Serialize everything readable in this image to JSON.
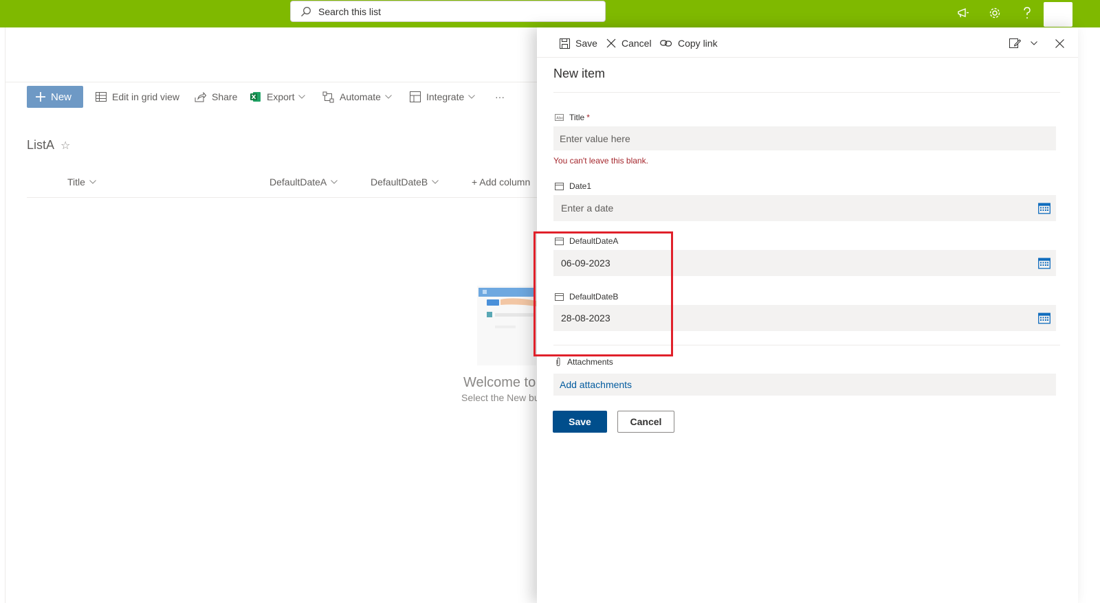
{
  "suite_bar": {
    "accent_color": "#7fb900",
    "search": {
      "placeholder": "Search this list"
    },
    "icons": [
      "megaphone-icon",
      "gear-icon",
      "help-icon"
    ]
  },
  "command_bar": {
    "new_label": "New",
    "edit_grid_label": "Edit in grid view",
    "share_label": "Share",
    "export_label": "Export",
    "automate_label": "Automate",
    "integrate_label": "Integrate",
    "more_label": "···"
  },
  "list": {
    "title": "ListA",
    "star": "☆",
    "columns": [
      "Title",
      "DefaultDateA",
      "DefaultDateB"
    ],
    "add_column_label": "+ Add column",
    "empty": {
      "title": "Welcome to",
      "subtitle": "Select the New bu"
    }
  },
  "panel": {
    "toolbar": {
      "save_label": "Save",
      "cancel_label": "Cancel",
      "copy_link_label": "Copy link"
    },
    "title": "New item",
    "fields": {
      "title": {
        "label": "Title",
        "required_mark": "*",
        "placeholder": "Enter value here",
        "error": "You can't leave this blank."
      },
      "date1": {
        "label": "Date1",
        "placeholder": "Enter a date"
      },
      "default_date_a": {
        "label": "DefaultDateA",
        "value": "06-09-2023"
      },
      "default_date_b": {
        "label": "DefaultDateB",
        "value": "28-08-2023"
      },
      "attachments": {
        "label": "Attachments",
        "link": "Add attachments"
      }
    },
    "save_button": "Save",
    "cancel_button": "Cancel",
    "primary_color": "#004e8c",
    "error_color": "#a4262c"
  },
  "annotation": {
    "highlight_color": "#e0202a"
  }
}
